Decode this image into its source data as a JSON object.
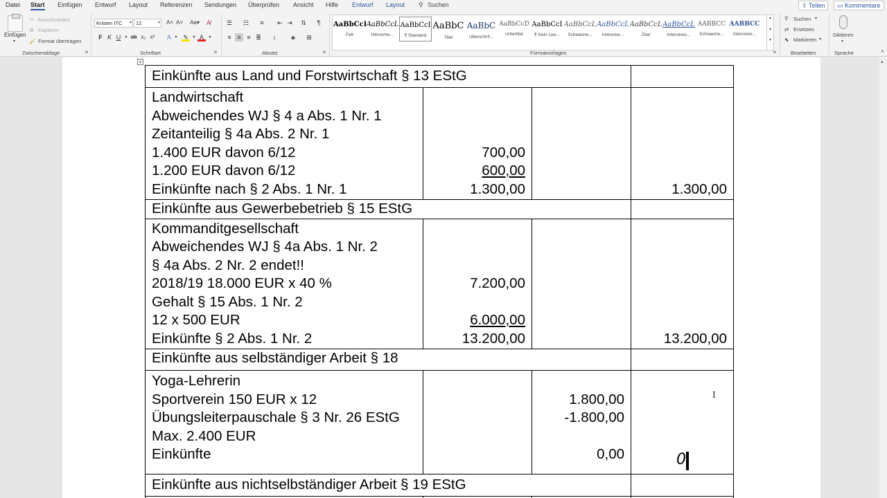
{
  "menu": {
    "tabs": [
      "Datei",
      "Start",
      "Einfügen",
      "Entwurf",
      "Layout",
      "Referenzen",
      "Sendungen",
      "Überprüfen",
      "Ansicht",
      "Hilfe",
      "Entwurf",
      "Layout"
    ],
    "active_tab": "Start",
    "search_label": "Suchen",
    "share_label": "Teilen",
    "comments_label": "Kommentare"
  },
  "ribbon": {
    "clipboard": {
      "paste_label": "Einfügen",
      "cut_label": "Ausschneiden",
      "copy_label": "Kopieren",
      "format_painter_label": "Format übertragen",
      "group_label": "Zwischenablage"
    },
    "font": {
      "font_name": "Kristen ITC",
      "font_size": "12",
      "group_label": "Schriftart"
    },
    "paragraph": {
      "group_label": "Absatz"
    },
    "styles": {
      "group_label": "Formatvorlagen",
      "items": [
        {
          "sample": "AaBbCcI",
          "name": "Fett"
        },
        {
          "sample": "AaBbCcL",
          "name": "Hervorhe..."
        },
        {
          "sample": "AaBbCcI",
          "name": "¶ Standard"
        },
        {
          "sample": "AaBbC",
          "name": "Titel"
        },
        {
          "sample": "AaBbC",
          "name": "Überschrif..."
        },
        {
          "sample": "AaBbCcD",
          "name": "Untertitel"
        },
        {
          "sample": "AaBbCcI",
          "name": "¶ Kein Lee..."
        },
        {
          "sample": "AaBbCcL",
          "name": "Schwache..."
        },
        {
          "sample": "AaBbCcL",
          "name": "Intensive..."
        },
        {
          "sample": "AaBbCcL",
          "name": "Zitat"
        },
        {
          "sample": "AaBbCcL",
          "name": "Intensives..."
        },
        {
          "sample": "AABBCC",
          "name": "Schwache..."
        },
        {
          "sample": "AABBCC",
          "name": "Intensiver..."
        }
      ],
      "selected_index": 2
    },
    "editing": {
      "find_label": "Suchen",
      "replace_label": "Ersetzen",
      "select_label": "Markieren",
      "group_label": "Bearbeiten"
    },
    "voice": {
      "dictate_label": "Diktieren",
      "group_label": "Sprache"
    }
  },
  "table": {
    "sections": [
      {
        "header": "Einkünfte aus Land und Forstwirtschaft § 13 EStG",
        "rows": [
          {
            "text": "Landwirtschaft",
            "col2": "",
            "col3": "",
            "col4": ""
          },
          {
            "text": "Abweichendes WJ § 4 a Abs. 1 Nr. 1",
            "col2": "",
            "col3": "",
            "col4": ""
          },
          {
            "text": "Zeitanteilig § 4a Abs. 2 Nr. 1",
            "col2": "",
            "col3": "",
            "col4": ""
          },
          {
            "text": "1.400 EUR davon 6/12",
            "col2": "700,00",
            "col3": "",
            "col4": ""
          },
          {
            "text": "1.200 EUR davon 6/12",
            "col2": "600,00",
            "col3": "",
            "col4": ""
          },
          {
            "text": "Einkünfte nach § 2 Abs. 1 Nr. 1",
            "col2": "1.300,00",
            "col3": "",
            "col4": "1.300,00"
          }
        ]
      },
      {
        "header": "Einkünfte aus Gewerbebetrieb § 15 EStG",
        "rows": [
          {
            "text": "Kommanditgesellschaft",
            "col2": "",
            "col3": "",
            "col4": ""
          },
          {
            "text": "Abweichendes WJ § 4a Abs. 1 Nr. 2",
            "col2": "",
            "col3": "",
            "col4": ""
          },
          {
            "text": "§ 4a Abs. 2 Nr. 2 endet!!",
            "col2": "",
            "col3": "",
            "col4": ""
          },
          {
            "text": "2018/19 18.000 EUR x 40 %",
            "col2": "7.200,00",
            "col3": "",
            "col4": ""
          },
          {
            "text": "Gehalt § 15 Abs. 1 Nr. 2",
            "col2": "",
            "col3": "",
            "col4": ""
          },
          {
            "text": "12 x 500 EUR",
            "col2": "6.000,00",
            "col3": "",
            "col4": ""
          },
          {
            "text": "Einkünfte § 2 Abs. 1 Nr. 2",
            "col2": "13.200,00",
            "col3": "",
            "col4": "13.200,00"
          }
        ]
      },
      {
        "header": "Einkünfte aus selbständiger Arbeit § 18",
        "rows": [
          {
            "text": "Yoga-Lehrerin",
            "col2": "",
            "col3": "",
            "col4": ""
          },
          {
            "text": "Sportverein 150 EUR x 12",
            "col2": "",
            "col3": "1.800,00",
            "col4": ""
          },
          {
            "text": "Übungsleiterpauschale § 3 Nr. 26 EStG",
            "col2": "",
            "col3": "-1.800,00",
            "col4": ""
          },
          {
            "text": "Max. 2.400 EUR",
            "col2": "",
            "col3": "",
            "col4": ""
          },
          {
            "text": "Einkünfte",
            "col2": "",
            "col3": "0,00",
            "col4": ""
          }
        ],
        "typed_value": "0"
      },
      {
        "header": "Einkünfte aus nichtselbständiger Arbeit § 19 EStG",
        "rows": []
      }
    ]
  }
}
